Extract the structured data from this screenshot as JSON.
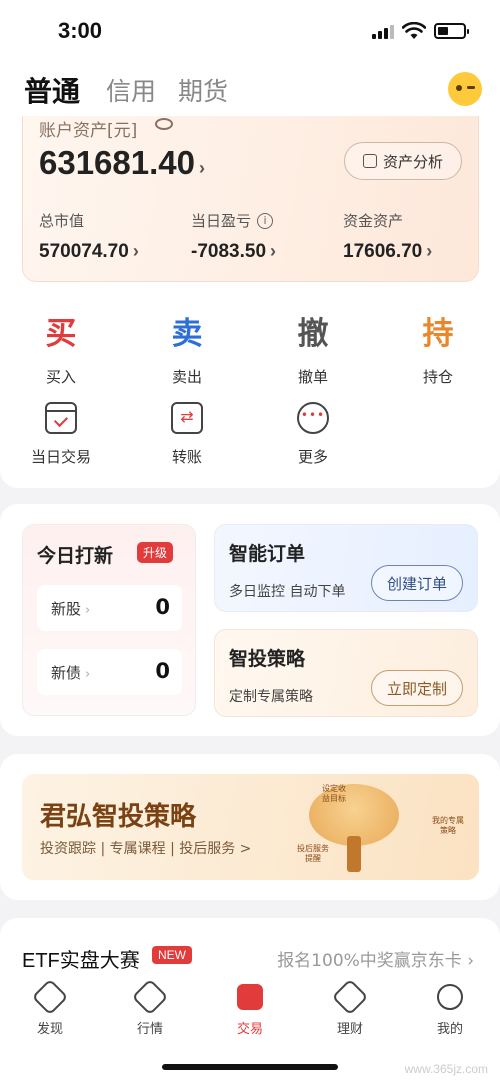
{
  "status": {
    "time": "3:00"
  },
  "header": {
    "tabs": [
      {
        "label": "普通"
      },
      {
        "label": "信用"
      },
      {
        "label": "期货"
      }
    ]
  },
  "assets": {
    "label": "账户资产[元]",
    "total": "631681.40",
    "analysis_button": "资产分析",
    "metrics": [
      {
        "label": "总市值",
        "value": "570074.70"
      },
      {
        "label": "当日盈亏",
        "value": "-7083.50"
      },
      {
        "label": "资金资产",
        "value": "17606.70"
      }
    ]
  },
  "actions": [
    {
      "glyph": "买",
      "label": "买入",
      "color": "#e23b3b"
    },
    {
      "glyph": "卖",
      "label": "卖出",
      "color": "#2d6fd6"
    },
    {
      "glyph": "撤",
      "label": "撤单",
      "color": "#555555"
    },
    {
      "glyph": "持",
      "label": "持仓",
      "color": "#e8872c"
    }
  ],
  "tools": [
    {
      "label": "当日交易",
      "icon": "calendar-icon"
    },
    {
      "label": "转账",
      "icon": "transfer-icon"
    },
    {
      "label": "更多",
      "icon": "more-icon"
    }
  ],
  "ipo": {
    "title": "今日打新",
    "badge": "升级",
    "rows": [
      {
        "label": "新股",
        "count": "0"
      },
      {
        "label": "新债",
        "count": "0"
      }
    ]
  },
  "smart_order": {
    "title": "智能订单",
    "subtitle": "多日监控 自动下单",
    "button": "创建订单"
  },
  "smart_strategy": {
    "title": "智投策略",
    "subtitle": "定制专属策略",
    "button": "立即定制"
  },
  "banner": {
    "title": "君弘智投策略",
    "subtitle": "投资跟踪 | 专属课程 | 投后服务 >",
    "tags": [
      "设定收益目标",
      "投后服务提醒",
      "我的专属策略"
    ]
  },
  "etf": {
    "title": "ETF实盘大赛",
    "badge": "NEW",
    "promo": "报名100%中奖赢京东卡"
  },
  "tabbar": {
    "items": [
      {
        "label": "发现",
        "active": false
      },
      {
        "label": "行情",
        "active": false
      },
      {
        "label": "交易",
        "active": true
      },
      {
        "label": "理财",
        "active": false
      },
      {
        "label": "我的",
        "active": false
      }
    ]
  },
  "watermark": "www.365jz.com"
}
